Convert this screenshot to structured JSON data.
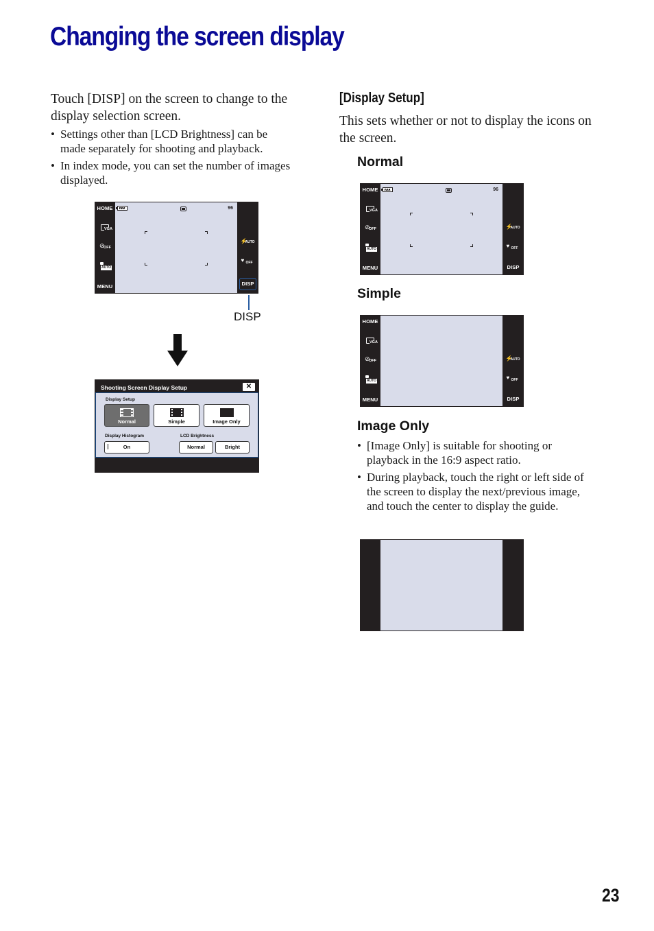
{
  "page": {
    "title": "Changing the screen display",
    "page_number": "23",
    "title_color": "#0a0a96"
  },
  "left": {
    "lead": "Touch [DISP] on the screen to change to the display selection screen.",
    "bullets": [
      "Settings other than [LCD Brightness] can be made separately for shooting and playback.",
      "In index mode, you can set the number of images displayed."
    ],
    "callout_label": "DISP",
    "arrow_icon": "down-arrow-icon"
  },
  "camera_screen": {
    "left_buttons": [
      "HOME",
      "VGA",
      "SELF-TIMER OFF",
      "SCENE AUTO",
      "MENU"
    ],
    "home_label": "HOME",
    "menu_label": "MENU",
    "disp_label": "DISP",
    "shots_remaining": "96",
    "right_icons": [
      "flash-auto-icon",
      "macro-off-icon"
    ]
  },
  "dialog": {
    "title": "Shooting Screen Display Setup",
    "close_label": "✕",
    "display_setup_label": "Display Setup",
    "display_options": [
      {
        "label": "Normal",
        "selected": true
      },
      {
        "label": "Simple",
        "selected": false
      },
      {
        "label": "Image Only",
        "selected": false
      }
    ],
    "histogram_label": "Display Histogram",
    "histogram_value": "On",
    "lcd_label": "LCD Brightness",
    "lcd_options": [
      {
        "label": "Normal"
      },
      {
        "label": "Bright"
      }
    ]
  },
  "right": {
    "section_title": "[Display Setup]",
    "section_text": "This sets whether or not to display the icons on the screen.",
    "normal_heading": "Normal",
    "simple_heading": "Simple",
    "imageonly_heading": "Image Only",
    "imageonly_bullets": [
      "[Image Only] is suitable for shooting or playback in the 16:9 aspect ratio.",
      "During playback, touch the right or left side of the screen to display the next/previous image, and touch the center to display the guide."
    ]
  }
}
